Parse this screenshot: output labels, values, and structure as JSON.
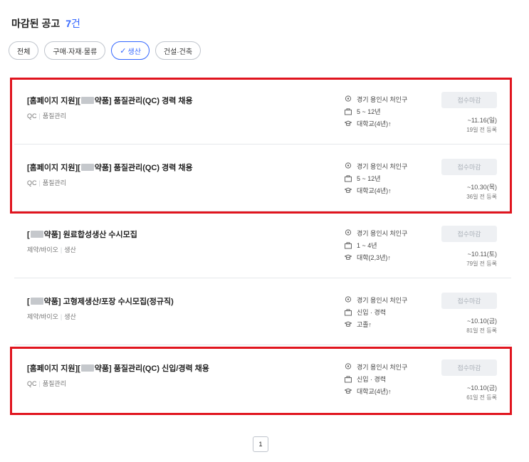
{
  "header": {
    "title": "마감된 공고",
    "count": "7",
    "count_unit": "건"
  },
  "filters": [
    {
      "label": "전체",
      "active": false
    },
    {
      "label": "구매·자재·물류",
      "active": false
    },
    {
      "label": "생산",
      "active": true
    },
    {
      "label": "건설·건축",
      "active": false
    }
  ],
  "jobs": [
    {
      "title_prefix": "[홈페이지 지원][",
      "title_suffix": "약품] 품질관리(QC) 경력 채용",
      "tag1": "QC",
      "tag2": "품질관리",
      "location": "경기 용인시 처인구",
      "career": "5 ~ 12년",
      "education": "대학교(4년)↑",
      "status": "접수마감",
      "deadline": "~11.16(일)",
      "posted": "19일 전 등록"
    },
    {
      "title_prefix": "[홈페이지 지원][",
      "title_suffix": "약품] 품질관리(QC) 경력 채용",
      "tag1": "QC",
      "tag2": "품질관리",
      "location": "경기 용인시 처인구",
      "career": "5 ~ 12년",
      "education": "대학교(4년)↑",
      "status": "접수마감",
      "deadline": "~10.30(목)",
      "posted": "36일 전 등록"
    },
    {
      "title_prefix": "[",
      "title_suffix": "약품] 원료합성생산 수시모집",
      "tag1": "제약/바이오",
      "tag2": "생산",
      "location": "경기 용인시 처인구",
      "career": "1 ~ 4년",
      "education": "대학(2,3년)↑",
      "status": "접수마감",
      "deadline": "~10.11(토)",
      "posted": "79일 전 등록"
    },
    {
      "title_prefix": "[",
      "title_suffix": "약품] 고형제생산/포장 수시모집(정규직)",
      "tag1": "제약/바이오",
      "tag2": "생산",
      "location": "경기 용인시 처인구",
      "career": "신입 · 경력",
      "education": "고졸↑",
      "status": "접수마감",
      "deadline": "~10.10(금)",
      "posted": "81일 전 등록"
    },
    {
      "title_prefix": "[홈페이지 지원][",
      "title_suffix": "약품] 품질관리(QC) 신입/경력 채용",
      "tag1": "QC",
      "tag2": "품질관리",
      "location": "경기 용인시 처인구",
      "career": "신입 · 경력",
      "education": "대학교(4년)↑",
      "status": "접수마감",
      "deadline": "~10.10(금)",
      "posted": "61일 전 등록"
    }
  ],
  "pagination": {
    "current": "1"
  },
  "colors": {
    "accent": "#3366ff",
    "highlight": "#e0141e"
  }
}
